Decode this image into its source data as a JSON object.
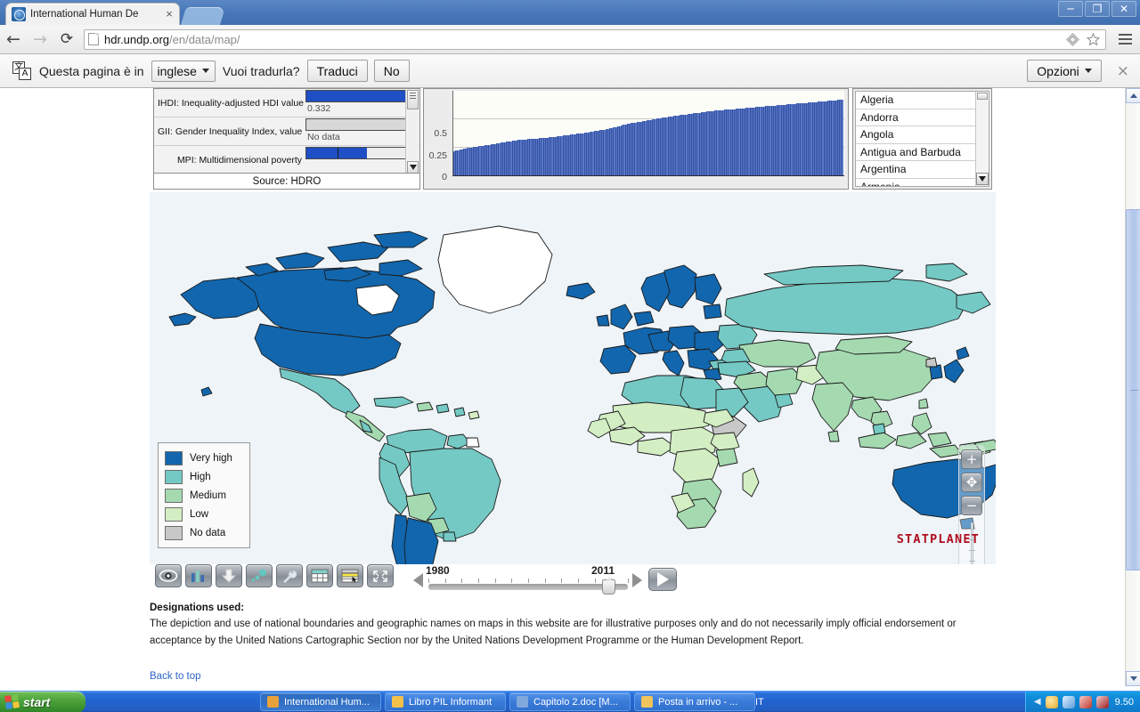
{
  "browser": {
    "tab_title": "International Human De",
    "tab_close": "×",
    "url_host": "hdr.undp.org",
    "url_path": "/en/data/map/",
    "back_icon": "←",
    "forward_icon": "→",
    "reload_icon": "⟳",
    "minimize": "─",
    "restore": "❐",
    "close": "✕"
  },
  "translate_bar": {
    "message": "Questa pagina è in",
    "language": "inglese",
    "question": "Vuoi tradurla?",
    "translate_button": "Traduci",
    "no_button": "No",
    "options_button": "Opzioni",
    "close_icon": "×"
  },
  "indicator_panel": {
    "rows": [
      {
        "label": "IHDI: Inequality-adjusted HDI value",
        "value": "0.332",
        "bar_type": "filled",
        "fill_pct": 100
      },
      {
        "label": "GII: Gender Inequality Index, value",
        "value": "No data",
        "bar_type": "nodata",
        "fill_pct": 0
      },
      {
        "label": "MPI: Multidimensional poverty",
        "value": "",
        "bar_type": "split",
        "fill_pct": 58
      }
    ],
    "source": "Source: HDRO"
  },
  "chart_data": {
    "type": "bar",
    "title": "",
    "xlabel": "",
    "ylabel": "",
    "ylim": [
      0,
      1
    ],
    "yticks": [
      0,
      0.25,
      0.5
    ],
    "ytick_labels": [
      "0",
      "0.25",
      "0.5"
    ],
    "grid": true,
    "legend": "none",
    "categories": [],
    "values": [
      0.286,
      0.295,
      0.3,
      0.305,
      0.31,
      0.314,
      0.318,
      0.322,
      0.326,
      0.33,
      0.333,
      0.337,
      0.34,
      0.343,
      0.346,
      0.35,
      0.353,
      0.356,
      0.36,
      0.364,
      0.368,
      0.372,
      0.376,
      0.38,
      0.385,
      0.39,
      0.394,
      0.398,
      0.402,
      0.405,
      0.408,
      0.411,
      0.413,
      0.416,
      0.418,
      0.42,
      0.423,
      0.425,
      0.427,
      0.429,
      0.431,
      0.433,
      0.435,
      0.437,
      0.439,
      0.441,
      0.443,
      0.445,
      0.447,
      0.449,
      0.452,
      0.455,
      0.458,
      0.461,
      0.464,
      0.467,
      0.47,
      0.473,
      0.476,
      0.479,
      0.482,
      0.485,
      0.488,
      0.491,
      0.494,
      0.497,
      0.5,
      0.503,
      0.506,
      0.51,
      0.514,
      0.518,
      0.522,
      0.526,
      0.53,
      0.534,
      0.538,
      0.542,
      0.547,
      0.552,
      0.557,
      0.562,
      0.567,
      0.572,
      0.577,
      0.583,
      0.589,
      0.595,
      0.601,
      0.607,
      0.612,
      0.617,
      0.621,
      0.625,
      0.629,
      0.633,
      0.637,
      0.641,
      0.645,
      0.649,
      0.653,
      0.657,
      0.661,
      0.665,
      0.669,
      0.673,
      0.677,
      0.681,
      0.685,
      0.689,
      0.693,
      0.697,
      0.7,
      0.703,
      0.706,
      0.709,
      0.712,
      0.715,
      0.718,
      0.721,
      0.724,
      0.727,
      0.73,
      0.733,
      0.736,
      0.739,
      0.742,
      0.745,
      0.748,
      0.751,
      0.754,
      0.757,
      0.76,
      0.762,
      0.764,
      0.766,
      0.768,
      0.77,
      0.772,
      0.774,
      0.776,
      0.778,
      0.78,
      0.782,
      0.784,
      0.786,
      0.788,
      0.79,
      0.792,
      0.794,
      0.796,
      0.798,
      0.8,
      0.802,
      0.804,
      0.806,
      0.808,
      0.81,
      0.812,
      0.814,
      0.816,
      0.818,
      0.82,
      0.822,
      0.824,
      0.826,
      0.828,
      0.83,
      0.832,
      0.834,
      0.836,
      0.838,
      0.84,
      0.842,
      0.844,
      0.846,
      0.848,
      0.85,
      0.852,
      0.854,
      0.856,
      0.858,
      0.86,
      0.862,
      0.864,
      0.866,
      0.868,
      0.87,
      0.872,
      0.874,
      0.876,
      0.878,
      0.88,
      0.882,
      0.884,
      0.886,
      0.888,
      0.89,
      0.892,
      0.894
    ],
    "bar_color": "#5a78c8"
  },
  "country_list": {
    "items": [
      "Algeria",
      "Andorra",
      "Angola",
      "Antigua and Barbuda",
      "Argentina",
      "Armenia"
    ]
  },
  "legend": {
    "items": [
      {
        "label": "Very high",
        "color": "#1266ad"
      },
      {
        "label": "High",
        "color": "#74c9c4"
      },
      {
        "label": "Medium",
        "color": "#a5dab0"
      },
      {
        "label": "Low",
        "color": "#d4eec3"
      },
      {
        "label": "No data",
        "color": "#c8c8c8"
      }
    ]
  },
  "toolbar": {
    "tools": [
      {
        "name": "view-icon",
        "title": "View"
      },
      {
        "name": "bar-chart-icon",
        "title": "Graph"
      },
      {
        "name": "download-icon",
        "title": "Download"
      },
      {
        "name": "bubble-icon",
        "title": "Bubble chart"
      },
      {
        "name": "wrench-icon",
        "title": "Settings"
      },
      {
        "name": "table-icon",
        "title": "Data table"
      },
      {
        "name": "highlight-icon",
        "title": "Highlight"
      },
      {
        "name": "fullscreen-icon",
        "title": "Full screen"
      }
    ]
  },
  "timeline": {
    "year_min": "1980",
    "year_max": "2011",
    "current": "2011",
    "play_label": "Play"
  },
  "map": {
    "zoom_in": "+",
    "zoom_out": "−",
    "recenter": "✥",
    "watermark": "STATPLANET",
    "background": "#eef4f8"
  },
  "designations": {
    "title": "Designations used:",
    "body": "The depiction and use of national boundaries and geographic names on maps in this website are for illustrative purposes only and do not necessarily imply official endorsement or acceptance by the United Nations Cartographic Section nor by the United Nations Development Programme or the Human Development Report.",
    "back_to_top": "Back to top"
  },
  "taskbar": {
    "start_label": "start",
    "tasks": [
      {
        "label": "International Hum...",
        "icon_color": "#e8a23c",
        "active": true
      },
      {
        "label": "Libro PIL Informant",
        "icon_color": "#f3c04a",
        "active": false
      },
      {
        "label": "Capitolo 2.doc [M...",
        "icon_color": "#7fa8dd",
        "active": false
      },
      {
        "label": "Posta in arrivo - ...",
        "icon_color": "#f0c45a",
        "active": false
      }
    ],
    "language": "IT",
    "clock": "9.50"
  }
}
